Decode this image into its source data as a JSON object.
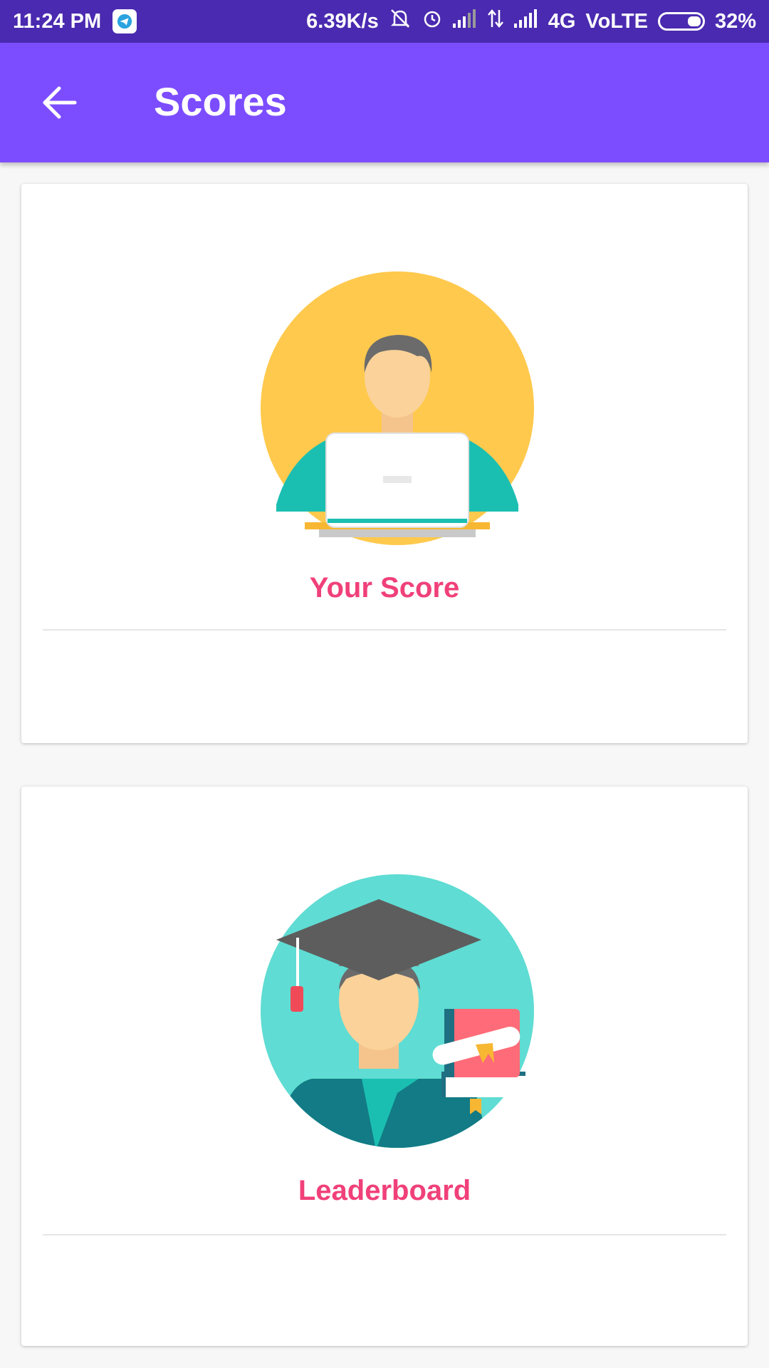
{
  "status_bar": {
    "time": "11:24 PM",
    "net_speed": "6.39K/s",
    "network": "4G",
    "volte": "VoLTE",
    "battery": "32%",
    "icons": [
      "telegram-icon",
      "mute-icon",
      "alarm-icon",
      "signal-icon",
      "data-arrows-icon",
      "signal-icon",
      "battery-icon"
    ]
  },
  "app_bar": {
    "title": "Scores",
    "back_icon": "arrow-left-icon"
  },
  "cards": [
    {
      "label": "Your Score",
      "illustration": "man-with-laptop"
    },
    {
      "label": "Leaderboard",
      "illustration": "graduate-with-books"
    }
  ],
  "colors": {
    "status_bar": "#4a2ab0",
    "app_bar": "#7c4dff",
    "label": "#f0407a",
    "circle_yellow": "#ffc94d",
    "circle_teal": "#5fdcd3"
  }
}
